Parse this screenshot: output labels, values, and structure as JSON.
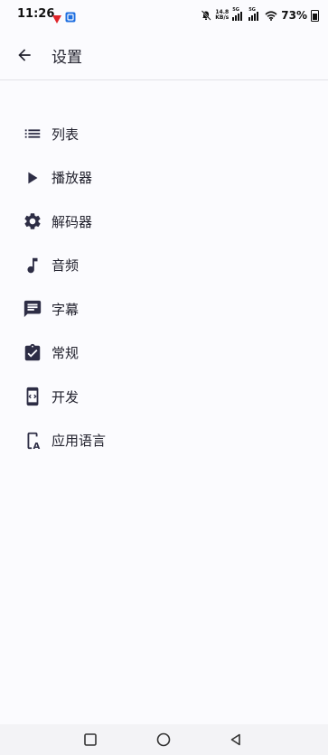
{
  "status_bar": {
    "time": "11:26",
    "net_speed_value": "14.8",
    "net_speed_unit": "KB/s",
    "signal1_label": "5G",
    "signal2_label": "5G",
    "battery": "73%"
  },
  "header": {
    "title": "设置"
  },
  "menu": {
    "items": [
      {
        "label": "列表",
        "icon": "list-icon"
      },
      {
        "label": "播放器",
        "icon": "play-icon"
      },
      {
        "label": "解码器",
        "icon": "gear-icon"
      },
      {
        "label": "音频",
        "icon": "music-note-icon"
      },
      {
        "label": "字幕",
        "icon": "subtitle-icon"
      },
      {
        "label": "常规",
        "icon": "clipboard-check-icon"
      },
      {
        "label": "开发",
        "icon": "developer-icon"
      },
      {
        "label": "应用语言",
        "icon": "app-language-icon"
      }
    ]
  },
  "colors": {
    "background": "#fbfbfe",
    "icon": "#2d2d45",
    "text": "#1f1f2b"
  }
}
